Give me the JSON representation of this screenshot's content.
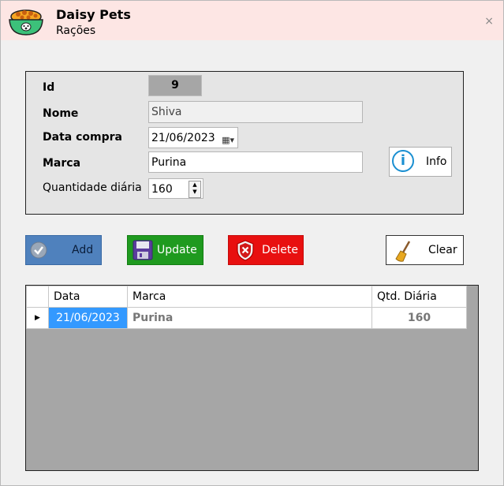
{
  "app": {
    "title": "Daisy Pets",
    "subtitle": "Rações",
    "close_label": "×"
  },
  "form": {
    "id_label": "Id",
    "id_value": "9",
    "nome_label": "Nome",
    "nome_value": "Shiva",
    "data_label": "Data compra",
    "data_value": "21/06/2023",
    "marca_label": "Marca",
    "marca_value": "Purina",
    "qtd_label": "Quantidade diária",
    "qtd_value": "160",
    "info_label": "Info"
  },
  "buttons": {
    "add": "Add",
    "update": "Update",
    "delete": "Delete",
    "clear": "Clear"
  },
  "grid": {
    "headers": [
      "Data",
      "Marca",
      "Qtd. Diária"
    ],
    "rows": [
      {
        "data": "21/06/2023",
        "marca": "Purina",
        "qtd": "160"
      }
    ]
  },
  "colors": {
    "titlebar": "#fde6e4",
    "add": "#4f81bd",
    "update": "#1f9a1f",
    "delete": "#e81010",
    "selection": "#3399ff"
  }
}
